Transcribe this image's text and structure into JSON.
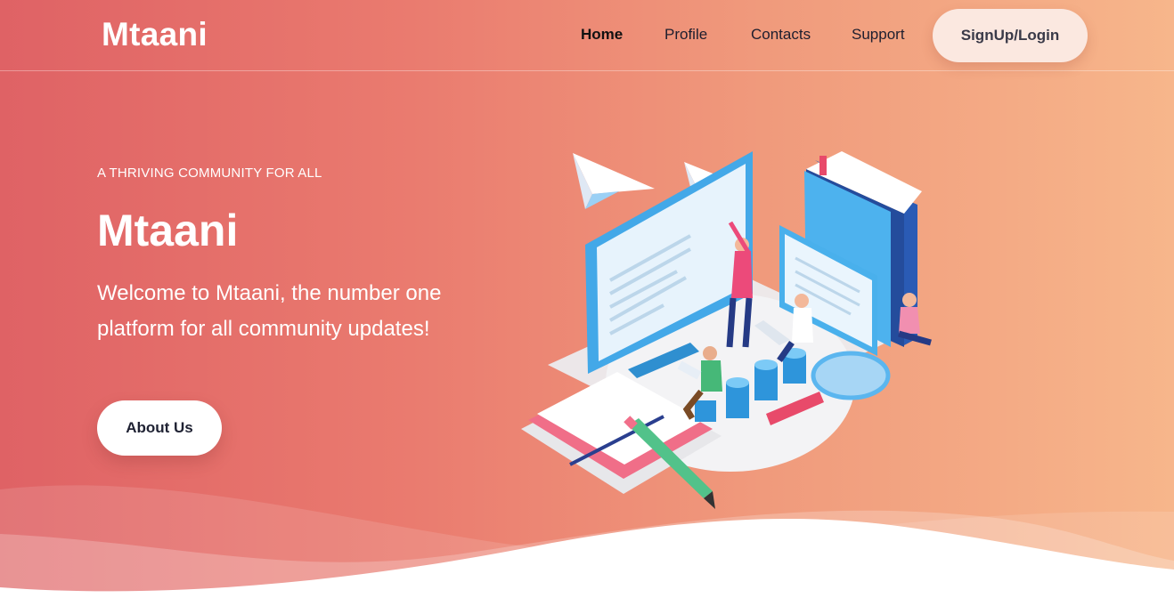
{
  "header": {
    "logo": "Mtaani",
    "nav": [
      {
        "label": "Home",
        "active": true
      },
      {
        "label": "Profile",
        "active": false
      },
      {
        "label": "Contacts",
        "active": false
      },
      {
        "label": "Support",
        "active": false
      }
    ],
    "cta_label": "SignUp/Login"
  },
  "hero": {
    "eyebrow": "A THRIVING COMMUNITY FOR ALL",
    "title": "Mtaani",
    "subtitle": "Welcome to Mtaani, the number one platform for all community updates!",
    "button_label": "About Us",
    "illustration": "community-isometric-illustration"
  },
  "colors": {
    "gradient_start": "#df6265",
    "gradient_end": "#f7b68b",
    "login_button_bg": "#fbe8e0",
    "text_dark": "#1e1e2e"
  }
}
